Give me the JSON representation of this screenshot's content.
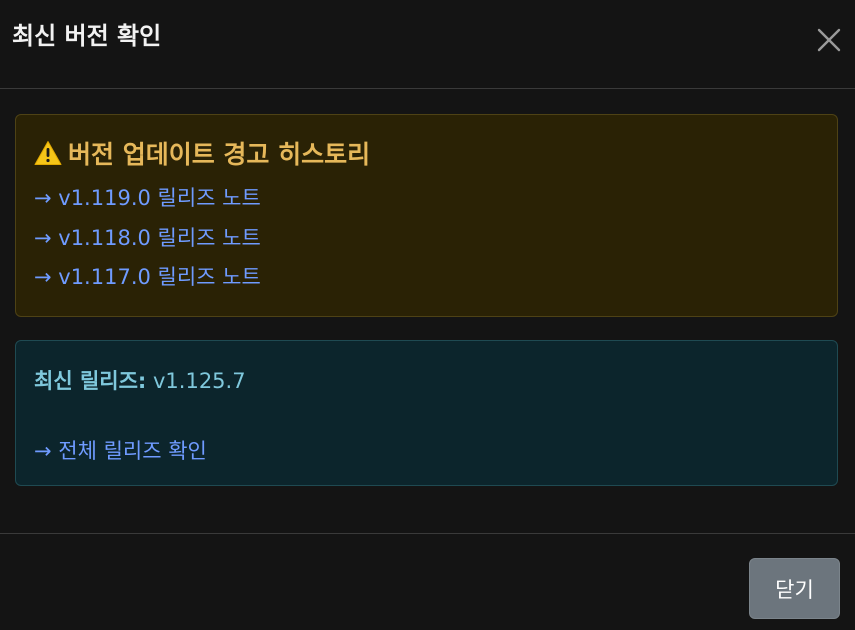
{
  "dialog": {
    "title": "최신 버전 확인",
    "close_icon": "close-icon"
  },
  "warning": {
    "icon": "warning-icon",
    "title": "버전 업데이트 경고 히스토리",
    "links": [
      "→ v1.119.0 릴리즈 노트",
      "→ v1.118.0 릴리즈 노트",
      "→ v1.117.0 릴리즈 노트"
    ]
  },
  "latest": {
    "label": "최신 릴리즈:",
    "version": "v1.125.7",
    "all_releases_link": "→ 전체 릴리즈 확인"
  },
  "footer": {
    "close_label": "닫기"
  },
  "colors": {
    "background": "#141414",
    "warning_bg": "#2a2205",
    "warning_title": "#e6b85a",
    "link": "#6f9bff",
    "info_bg": "#0c252c",
    "info_text": "#7fc8dc",
    "button_bg": "#6c757d"
  }
}
